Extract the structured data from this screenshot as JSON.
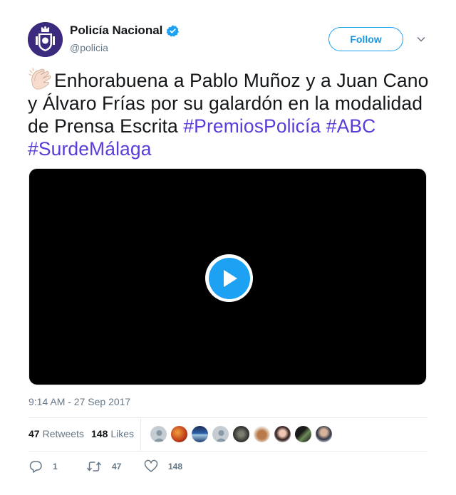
{
  "author": {
    "name": "Policía Nacional",
    "handle": "@policia",
    "verified": true,
    "avatar_icon": "police-crest-icon",
    "brand_color": "#3b2a7e"
  },
  "follow_label": "Follow",
  "tweet": {
    "emoji_icon": "clapping-hands-icon",
    "text": "Enhorabuena a Pablo Muñoz y a Juan Cano y Álvaro Frías por su galardón en la modalidad de Prensa Escrita",
    "hashtags": [
      "#PremiosPolicía",
      "#ABC",
      "#SurdeMálaga"
    ],
    "hashtag_color": "#5b3cd9"
  },
  "media": {
    "type": "video",
    "play_icon": "play-icon",
    "accent": "#1da1f2"
  },
  "timestamp": "9:14 AM - 27 Sep 2017",
  "stats": {
    "retweets_count": "47",
    "retweets_label": "Retweets",
    "likes_count": "148",
    "likes_label": "Likes"
  },
  "liked_by_avatars": [
    {
      "icon": "default-avatar-icon",
      "color": "#c5cdd3"
    },
    {
      "icon": "user-avatar-icon",
      "color": "#d0621f"
    },
    {
      "icon": "user-avatar-icon",
      "color": "#23457a"
    },
    {
      "icon": "default-avatar-icon",
      "color": "#c5cdd3"
    },
    {
      "icon": "user-avatar-icon",
      "color": "#2c2c2c"
    },
    {
      "icon": "user-avatar-icon",
      "color": "#b3714a"
    },
    {
      "icon": "user-avatar-icon",
      "color": "#d26a7a"
    },
    {
      "icon": "user-avatar-icon",
      "color": "#2d3a2a"
    },
    {
      "icon": "user-avatar-icon",
      "color": "#4a4f63"
    }
  ],
  "actions": {
    "reply_count": "1",
    "retweet_count": "47",
    "like_count": "148"
  }
}
